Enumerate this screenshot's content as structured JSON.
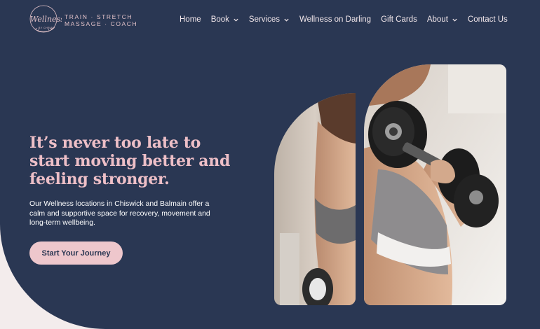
{
  "brand": {
    "logo_script": "Wellness",
    "logo_sub": "BY CHRIS",
    "tagline_line1": "TRAIN · STRETCH",
    "tagline_line2": "MASSAGE · COACH"
  },
  "nav": {
    "items": [
      {
        "label": "Home",
        "dropdown": false
      },
      {
        "label": "Book",
        "dropdown": true
      },
      {
        "label": "Services",
        "dropdown": true
      },
      {
        "label": "Wellness on Darling",
        "dropdown": false
      },
      {
        "label": "Gift Cards",
        "dropdown": false
      },
      {
        "label": "About",
        "dropdown": true
      },
      {
        "label": "Contact Us",
        "dropdown": false
      }
    ]
  },
  "hero": {
    "headline": "It’s never too late to start moving better and feeling stronger.",
    "intro": "Our Wellness locations in Chiswick and Balmain offer a calm and supportive space for recovery, movement and long-term wellbeing.",
    "cta_label": "Start Your Journey"
  },
  "colors": {
    "navy": "#2a3753",
    "pink": "#edbfc7",
    "cream": "#f3ecec"
  }
}
